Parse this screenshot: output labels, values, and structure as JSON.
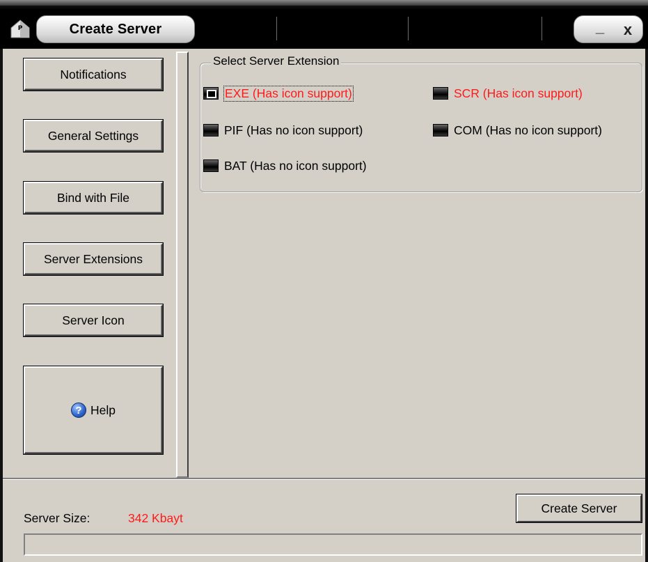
{
  "window": {
    "title": "Create Server",
    "minimize_glyph": "_",
    "close_glyph": "x",
    "app_icon": "house-p-icon"
  },
  "nav": {
    "items": [
      {
        "label": "Notifications"
      },
      {
        "label": "General Settings"
      },
      {
        "label": "Bind with File"
      },
      {
        "label": "Server Extensions"
      },
      {
        "label": "Server Icon"
      },
      {
        "label": "Help",
        "icon": "help-icon"
      }
    ]
  },
  "extensions": {
    "group_title": "Select Server Extension",
    "options": [
      {
        "label": "EXE (Has icon support)",
        "checked": true,
        "color": "#ff1a1a"
      },
      {
        "label": "SCR (Has icon support)",
        "checked": false,
        "color": "#ff1a1a"
      },
      {
        "label": "PIF (Has no icon support)",
        "checked": false,
        "color": "#000000"
      },
      {
        "label": "COM (Has no icon support)",
        "checked": false,
        "color": "#000000"
      },
      {
        "label": "BAT (Has no icon support)",
        "checked": false,
        "color": "#000000"
      }
    ]
  },
  "footer": {
    "size_label": "Server Size:",
    "size_value": "342 Kbayt",
    "create_button": "Create Server",
    "progress": 0
  },
  "colors": {
    "accent_red": "#ff1a1a",
    "face": "#d4d0c8"
  }
}
